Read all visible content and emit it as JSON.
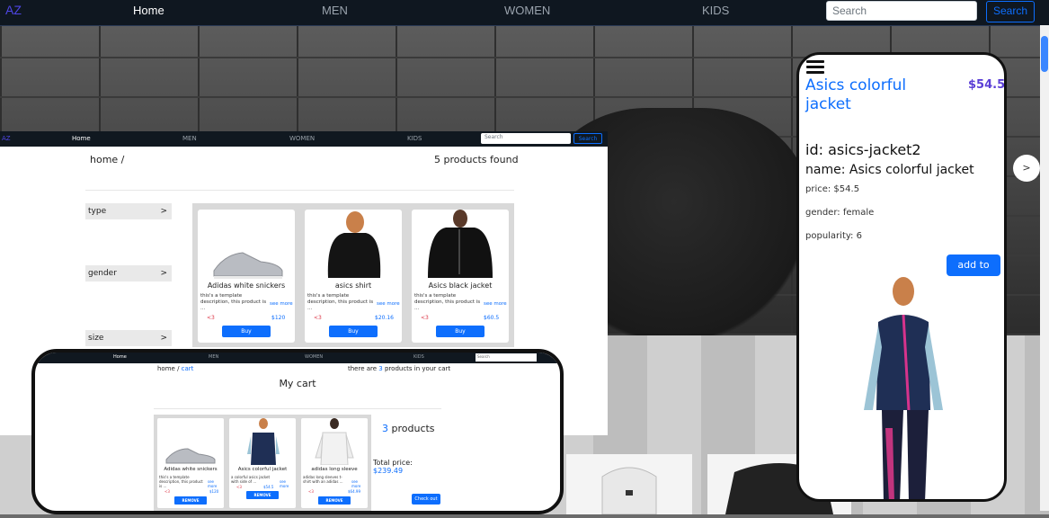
{
  "topnav": {
    "logo": "AZ",
    "items": [
      "Home",
      "MEN",
      "WOMEN",
      "KIDS"
    ],
    "search_placeholder": "Search",
    "search_button": "Search"
  },
  "listing": {
    "nav": {
      "logo": "AZ",
      "items": [
        "Home",
        "MEN",
        "WOMEN",
        "KIDS"
      ],
      "search_placeholder": "Search",
      "search_button": "Search"
    },
    "breadcrumb": "home /",
    "found": "5 products found",
    "filters": [
      {
        "label": "type",
        "chevron": ">"
      },
      {
        "label": "gender",
        "chevron": ">"
      },
      {
        "label": "size",
        "chevron": ">"
      }
    ],
    "products": [
      {
        "title": "Adidas white snickers",
        "desc": "this's a template description, this product is ...",
        "more": "see more",
        "heart": "<3",
        "price": "$120",
        "buy": "Buy"
      },
      {
        "title": "asics shirt",
        "desc": "this's a template description, this product is ...",
        "more": "see more",
        "heart": "<3",
        "price": "$20.16",
        "buy": "Buy"
      },
      {
        "title": "Asics black jacket",
        "desc": "this's a template description, this product is ...",
        "more": "see more",
        "heart": "<3",
        "price": "$60.5",
        "buy": "Buy"
      }
    ]
  },
  "cart": {
    "nav": {
      "items": [
        "Home",
        "MEN",
        "WOMEN",
        "KIDS"
      ],
      "search_placeholder": "Search"
    },
    "breadcrumb_home": "home / ",
    "breadcrumb_link": "cart",
    "count_prefix": "there are ",
    "count_value": "3",
    "count_suffix": " products in your cart",
    "title": "My cart",
    "items": [
      {
        "title": "Adidas white snickers",
        "desc": "this's a template description, this product is ...",
        "more": "see more",
        "heart": "<3",
        "price": "$120",
        "remove": "REMOVE"
      },
      {
        "title": "Asics colorful jacket",
        "desc": "a colorful asics jacket with side of ...",
        "more": "see more",
        "heart": "<3",
        "price": "$54.5",
        "remove": "REMOVE"
      },
      {
        "title": "adidas long sleeve",
        "desc": "adidas long sleeves t-shirt with an adidas ...",
        "more": "see more",
        "heart": "<3",
        "price": "$64.99",
        "remove": "REMOVE"
      }
    ],
    "products_count": "3",
    "products_label": " products",
    "total_label": "Total price:",
    "total_value": "$239.49",
    "checkout": "Check out"
  },
  "detail": {
    "title": "Asics colorful jacket",
    "price": "$54.5",
    "id_line": "id: asics-jacket2",
    "name_line": "name: Asics colorful jacket",
    "price_line": "price: $54.5",
    "gender_line": "gender: female",
    "popularity_line": "popularity: 6",
    "add_to_cart": "add to cart"
  },
  "carousel_next": ">",
  "colors": {
    "accent": "#0d6efd",
    "nav_bg": "#0f1720",
    "price_purple": "#5b3fd6",
    "heart": "#dc3545"
  }
}
